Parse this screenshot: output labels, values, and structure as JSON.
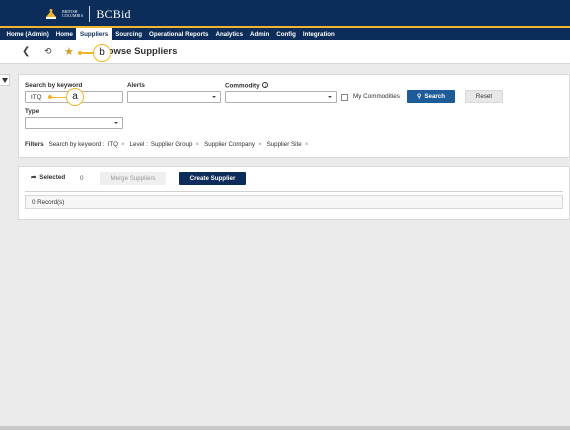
{
  "header": {
    "logo_line1": "BRITISH",
    "logo_line2": "COLUMBIA",
    "logo_app": "BCBid"
  },
  "nav": {
    "items": [
      {
        "label": "Home (Admin)"
      },
      {
        "label": "Home"
      },
      {
        "label": "Suppliers"
      },
      {
        "label": "Sourcing"
      },
      {
        "label": "Operational Reports"
      },
      {
        "label": "Analytics"
      },
      {
        "label": "Admin"
      },
      {
        "label": "Config"
      },
      {
        "label": "Integration"
      }
    ],
    "active": "Suppliers"
  },
  "titlebar": {
    "back_icon": "chevron-left-icon",
    "history_icon": "history-icon",
    "favorite_icon": "star-icon",
    "page_title": "rowse Suppliers"
  },
  "callouts": {
    "a": "a",
    "b": "b"
  },
  "search": {
    "keyword_label": "Search by keyword",
    "keyword_value": "ITQ",
    "alerts_label": "Alerts",
    "alerts_value": "",
    "commodity_label": "Commodity",
    "commodity_value": "",
    "my_commodities_label": "My Commodities",
    "my_commodities_checked": false,
    "search_button": "Search",
    "reset_button": "Reset",
    "type_label": "Type",
    "type_value": ""
  },
  "filters": {
    "label": "Filters",
    "keyword_prefix": "Search by keyword :",
    "keyword_chip": "ITQ",
    "level_prefix": "Level :",
    "level_chips": [
      "Supplier Group",
      "Supplier Company",
      "Supplier Site"
    ]
  },
  "results": {
    "selected_label": "Selected",
    "selected_count": "0",
    "merge_button": "Merge Suppliers",
    "create_button": "Create Supplier",
    "records_text": "0 Record(s)"
  },
  "colors": {
    "brand_navy": "#0c2d5a",
    "brand_gold": "#f2b62b",
    "primary_blue": "#1d5b99"
  }
}
